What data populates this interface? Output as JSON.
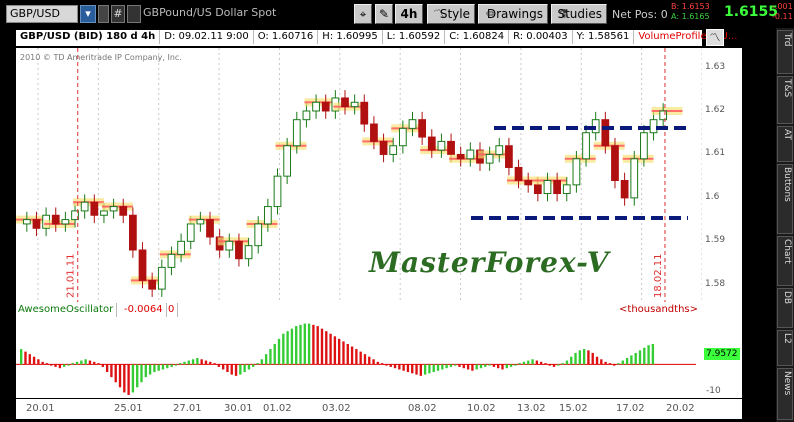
{
  "toolbar": {
    "symbol": "GBP/USD",
    "hash_label": "#",
    "description": "GBPound/US Dollar Spot",
    "aggregation": "4h",
    "style_label": "Style",
    "drawings_label": "Drawings",
    "studies_label": "Studies",
    "net_pos": "Net Pos: 0",
    "bid": "B: 1.6153",
    "ask": "A: 1.6165",
    "last": "1.6155",
    "change1": "-.001",
    "change2": "-0.11"
  },
  "header": {
    "symbol": "GBP/USD (BID) 180 d 4h",
    "date": "D: 09.02.11 9:00",
    "open": "O: 1.60716",
    "high": "H: 1.60995",
    "low": "L: 1.60592",
    "close": "C: 1.60824",
    "range": "R: 0.00403",
    "y": "Y: 1.58561",
    "volume_profile": "VolumeProfile (AU..."
  },
  "copyright": "2010 © TD Ameritrade IP Company, Inc.",
  "watermark": "MasterForex-V",
  "vlines": [
    {
      "label": "21.01.11",
      "color": "#e03030"
    },
    {
      "label": "18.02.11",
      "color": "#e03030"
    }
  ],
  "price_axis": [
    "1.63",
    "1.62",
    "1.61",
    "1.6",
    "1.59",
    "1.58"
  ],
  "price_range": [
    1.5735,
    1.6345
  ],
  "oscillator": {
    "name": "AwesomeOscillator",
    "value1": "-0.0064",
    "value2": "0",
    "units": "<thousandths>",
    "current": "7.9572",
    "min_label": "-10",
    "values": [
      6,
      5,
      4,
      3,
      2,
      1,
      0.5,
      -0.5,
      -1,
      -1.5,
      -1,
      -0.5,
      0.5,
      1,
      1.5,
      2,
      1.5,
      1,
      0.5,
      -1,
      -3,
      -5,
      -7,
      -9,
      -11,
      -12,
      -11,
      -9,
      -7,
      -5,
      -4,
      -3,
      -2.5,
      -2,
      -1.5,
      -1,
      -0.5,
      0.5,
      1,
      1.5,
      2,
      2.5,
      2,
      1.5,
      1,
      0.5,
      -1,
      -2,
      -3,
      -4,
      -4.5,
      -4,
      -3,
      -2,
      -1,
      0.5,
      2,
      4,
      6,
      8,
      10,
      12,
      13,
      14,
      15,
      15.5,
      16,
      16,
      15.5,
      15,
      14,
      13,
      12,
      11,
      10,
      9,
      8,
      7,
      6,
      5,
      4,
      3,
      2,
      1,
      0.5,
      -0.5,
      -1,
      -1.5,
      -2,
      -2.5,
      -3,
      -3.5,
      -4,
      -4.5,
      -4,
      -3.5,
      -3,
      -2.5,
      -2,
      -1.5,
      -1,
      -0.5,
      -1,
      -1.5,
      -2,
      -2.5,
      -2,
      -1.5,
      -1,
      -0.5,
      -1,
      -1.5,
      -2,
      -1.5,
      -1,
      -0.5,
      0.5,
      1,
      1.5,
      2,
      1.5,
      1,
      0.5,
      -0.5,
      -1,
      -0.5,
      0.5,
      1.5,
      3,
      4.5,
      5.5,
      6,
      5.5,
      4.5,
      3,
      2,
      1,
      0.5,
      -0.5,
      0.5,
      1.5,
      2.5,
      3.5,
      4.5,
      5.5,
      6.5,
      7.5,
      8
    ],
    "range": [
      -12,
      17
    ]
  },
  "x_axis": [
    "20.01",
    "25.01",
    "27.01",
    "30.01",
    "01.02",
    "03.02",
    "08.02",
    "10.02",
    "13.02",
    "15.02",
    "17.02",
    "20.02"
  ],
  "sidebar_tabs": [
    "Trd",
    "T&S",
    "AT",
    "Buttons",
    "Chart",
    "DB",
    "L2",
    "News"
  ],
  "colors": {
    "up_bar": "#1a7a1a",
    "down_bar": "#b01010",
    "osc_up": "#33cc33",
    "osc_down": "#dd1111",
    "channel": "#0a1a7a",
    "vp_red": "#ff6060",
    "vp_yellow": "#f6e37a"
  },
  "chart_data": {
    "type": "candlestick",
    "x_start_label": "20.01",
    "x_end_label": "20.02",
    "close_series": [
      1.595,
      1.593,
      1.596,
      1.594,
      1.595,
      1.597,
      1.599,
      1.596,
      1.597,
      1.598,
      1.596,
      1.588,
      1.581,
      1.579,
      1.584,
      1.587,
      1.59,
      1.594,
      1.595,
      1.591,
      1.588,
      1.59,
      1.586,
      1.589,
      1.594,
      1.598,
      1.605,
      1.612,
      1.618,
      1.62,
      1.622,
      1.62,
      1.623,
      1.621,
      1.622,
      1.617,
      1.613,
      1.61,
      1.612,
      1.616,
      1.618,
      1.614,
      1.611,
      1.613,
      1.61,
      1.609,
      1.611,
      1.608,
      1.61,
      1.612,
      1.607,
      1.604,
      1.603,
      1.601,
      1.604,
      1.601,
      1.603,
      1.609,
      1.615,
      1.618,
      1.612,
      1.604,
      1.6,
      1.609,
      1.615,
      1.618,
      1.62
    ]
  }
}
